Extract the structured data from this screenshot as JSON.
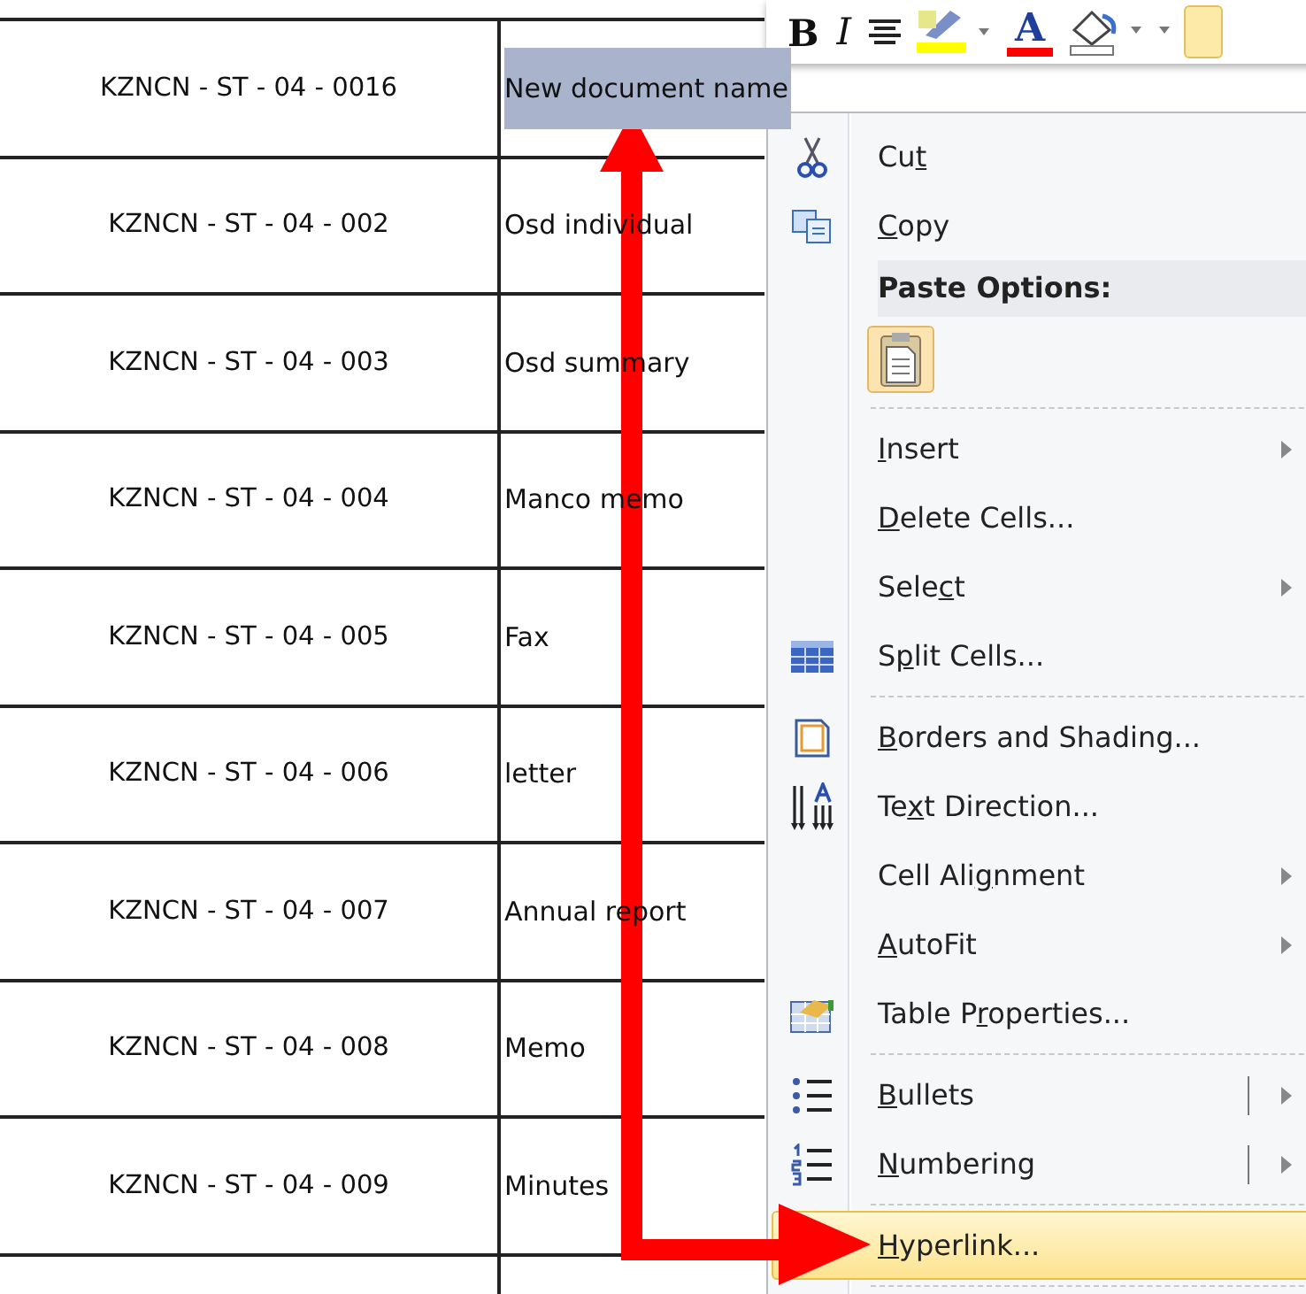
{
  "table": {
    "rows": [
      {
        "id": "KZNCN - ST - 04 - 0016",
        "name": "New document name",
        "selected": true
      },
      {
        "id": "KZNCN - ST - 04 - 002",
        "name": "Osd individual",
        "selected": false
      },
      {
        "id": "KZNCN - ST - 04 - 003",
        "name": "Osd summary",
        "selected": false
      },
      {
        "id": "KZNCN - ST - 04 - 004",
        "name": "Manco memo",
        "selected": false
      },
      {
        "id": "KZNCN - ST - 04 - 005",
        "name": "Fax",
        "selected": false
      },
      {
        "id": "KZNCN - ST - 04 - 006",
        "name": "letter",
        "selected": false
      },
      {
        "id": "KZNCN - ST - 04 - 007",
        "name": "Annual report",
        "selected": false
      },
      {
        "id": "KZNCN - ST - 04 - 008",
        "name": "Memo",
        "selected": false
      },
      {
        "id": "KZNCN - ST - 04 - 009",
        "name": "Minutes",
        "selected": false
      }
    ]
  },
  "mini_toolbar": {
    "buttons": [
      {
        "kind": "bold",
        "glyph": "B"
      },
      {
        "kind": "italic",
        "glyph": "I"
      },
      {
        "kind": "center"
      },
      {
        "kind": "highlight"
      },
      {
        "kind": "font_color",
        "glyph": "A"
      },
      {
        "kind": "shading"
      }
    ]
  },
  "context_menu": {
    "items": [
      {
        "kind": "command",
        "label": {
          "before": "Cu",
          "key": "t"
        },
        "submenu": false,
        "split": false,
        "selected": false
      },
      {
        "kind": "command",
        "label": {
          "key": "C",
          "after": "opy"
        },
        "submenu": false,
        "split": false,
        "selected": false
      },
      {
        "kind": "header",
        "label": "Paste Options:"
      },
      {
        "kind": "paste"
      },
      {
        "kind": "separator"
      },
      {
        "kind": "command",
        "label": {
          "key": "I",
          "after": "nsert"
        },
        "submenu": true,
        "split": false,
        "selected": false
      },
      {
        "kind": "command",
        "label": {
          "key": "D",
          "after": "elete Cells..."
        },
        "submenu": false,
        "split": false,
        "selected": false
      },
      {
        "kind": "command",
        "label": {
          "before": "Sele",
          "key": "c",
          "after": "t"
        },
        "submenu": true,
        "split": false,
        "selected": false
      },
      {
        "kind": "command",
        "label": {
          "before": "S",
          "key": "p",
          "after": "lit Cells..."
        },
        "submenu": false,
        "split": false,
        "selected": false
      },
      {
        "kind": "separator"
      },
      {
        "kind": "command",
        "label": {
          "key": "B",
          "after": "orders and Shading..."
        },
        "submenu": false,
        "split": false,
        "selected": false
      },
      {
        "kind": "command",
        "label": {
          "before": "Te",
          "key": "x",
          "after": "t Direction..."
        },
        "submenu": false,
        "split": false,
        "selected": false
      },
      {
        "kind": "command",
        "label": {
          "before": "Cell Ali",
          "key": "g",
          "after": "nment"
        },
        "submenu": true,
        "split": false,
        "selected": false
      },
      {
        "kind": "command",
        "label": {
          "key": "A",
          "after": "utoFit"
        },
        "submenu": true,
        "split": false,
        "selected": false
      },
      {
        "kind": "command",
        "label": {
          "before": "Table P",
          "key": "r",
          "after": "operties..."
        },
        "submenu": false,
        "split": false,
        "selected": false
      },
      {
        "kind": "separator"
      },
      {
        "kind": "command",
        "label": {
          "key": "B",
          "after": "ullets"
        },
        "submenu": true,
        "split": true,
        "selected": false
      },
      {
        "kind": "command",
        "label": {
          "key": "N",
          "after": "umbering"
        },
        "submenu": true,
        "split": true,
        "selected": false
      },
      {
        "kind": "separator"
      },
      {
        "kind": "command",
        "label": {
          "key": "H",
          "after": "yperlink..."
        },
        "submenu": false,
        "split": false,
        "selected": true
      },
      {
        "kind": "separator"
      }
    ]
  }
}
